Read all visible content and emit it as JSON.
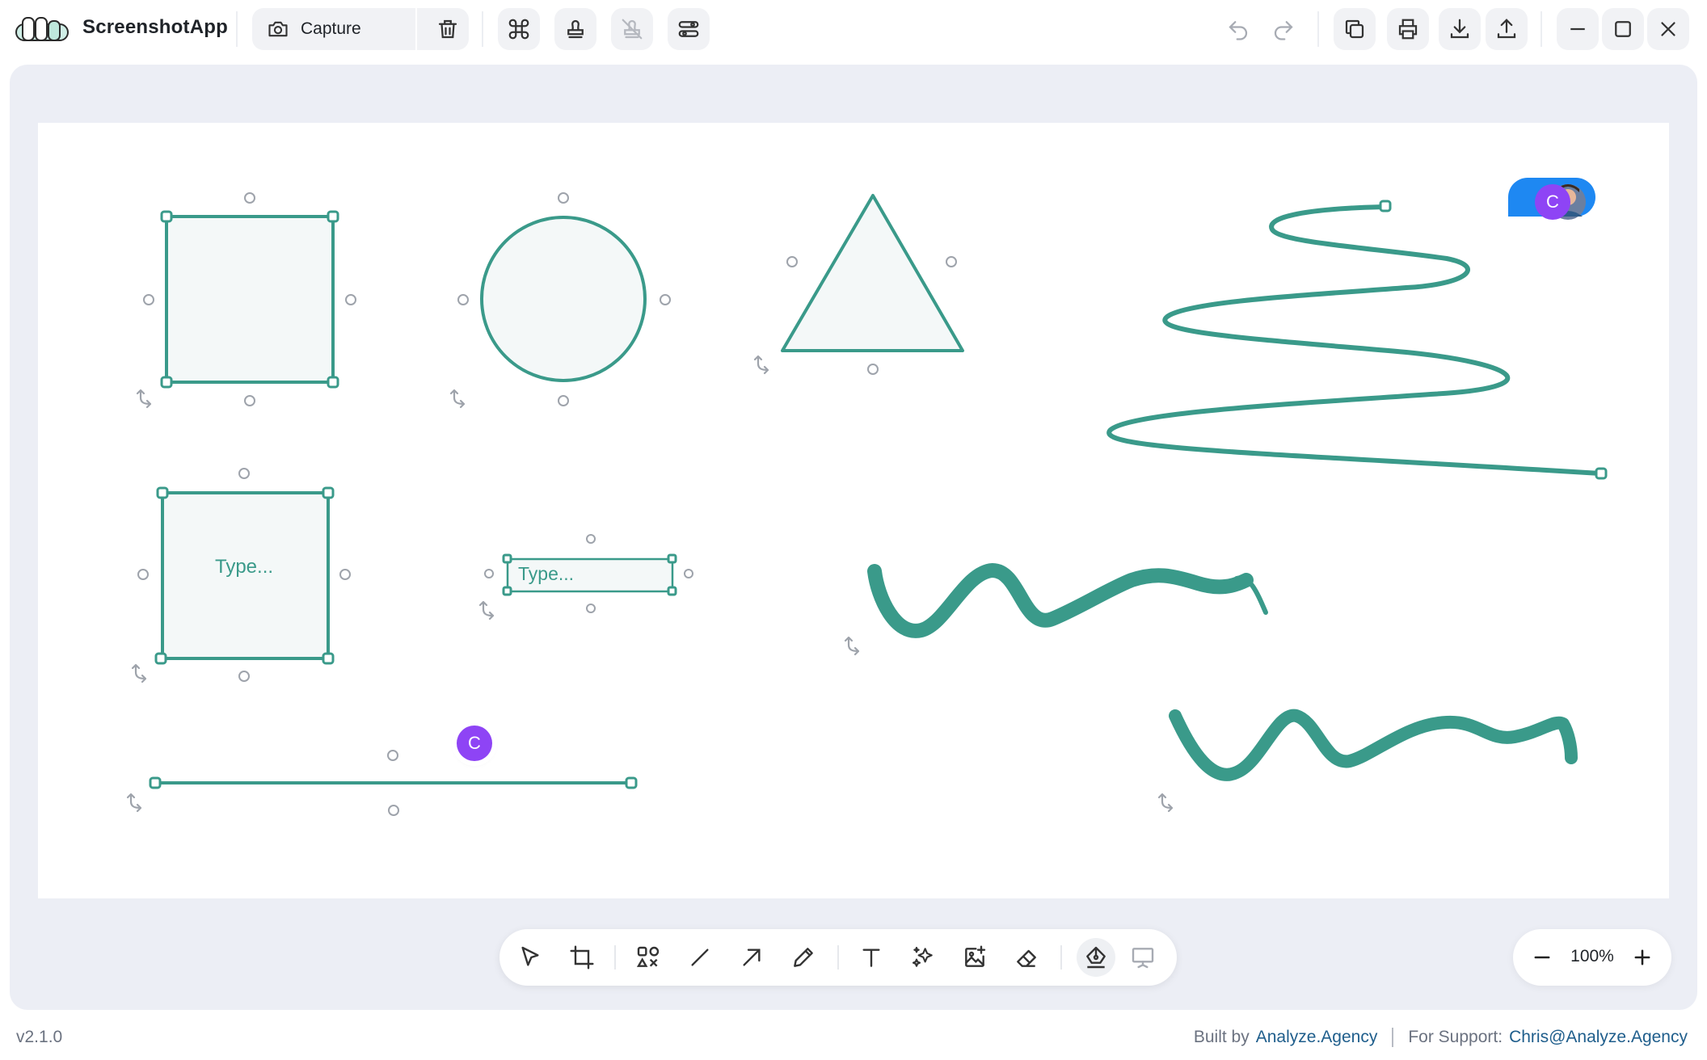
{
  "app": {
    "name": "ScreenshotApp"
  },
  "toolbar_top": {
    "capture_label": "Capture",
    "icons": [
      "camera-icon",
      "chevron-down-icon",
      "trash-icon",
      "command-icon",
      "stamp-icon",
      "stamp-off-icon",
      "sliders-icon",
      "undo-icon",
      "redo-icon",
      "copy-icon",
      "print-icon",
      "download-icon",
      "share-icon",
      "minimize-icon",
      "maximize-icon",
      "close-icon"
    ]
  },
  "canvas": {
    "text_placeholders": [
      "Type...",
      "Type..."
    ],
    "collaborators": [
      {
        "initial": "C",
        "color": "#8e44f5"
      },
      {
        "initial": "C",
        "color": "#8e44f5"
      }
    ],
    "accent": "#3a9a8a",
    "presence_bubble_color": "#1e88f2"
  },
  "tools": [
    "select",
    "crop",
    "shapes",
    "line",
    "arrow",
    "pen",
    "text",
    "magic",
    "add-image",
    "eraser",
    "pen-tool",
    "presentation"
  ],
  "zoom": {
    "value": "100%"
  },
  "footer": {
    "version": "v2.1.0",
    "built_by_prefix": "Built by",
    "built_by_link": "Analyze.Agency",
    "support_prefix": "For Support:",
    "support_link": "Chris@Analyze.Agency"
  }
}
